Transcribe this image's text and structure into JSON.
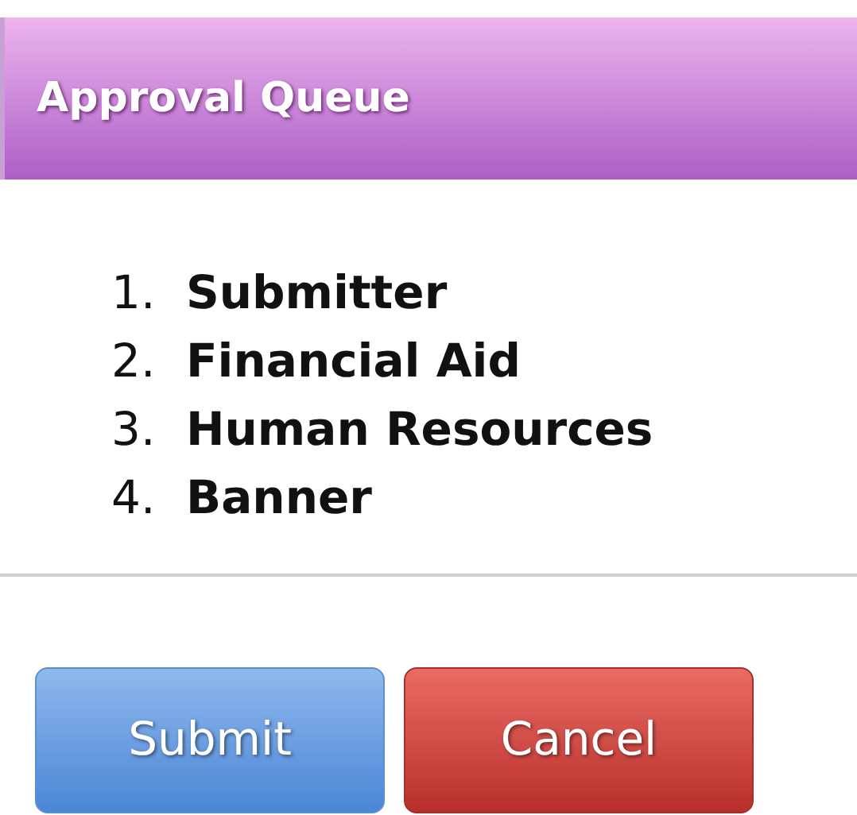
{
  "header": {
    "title": "Approval Queue"
  },
  "queue": [
    {
      "number": "1.",
      "label": "Submitter"
    },
    {
      "number": "2.",
      "label": "Financial Aid"
    },
    {
      "number": "3.",
      "label": "Human Resources"
    },
    {
      "number": "4.",
      "label": "Banner"
    }
  ],
  "buttons": [
    {
      "label": "Submit",
      "kind": "primary"
    },
    {
      "label": "Cancel",
      "kind": "danger"
    }
  ]
}
